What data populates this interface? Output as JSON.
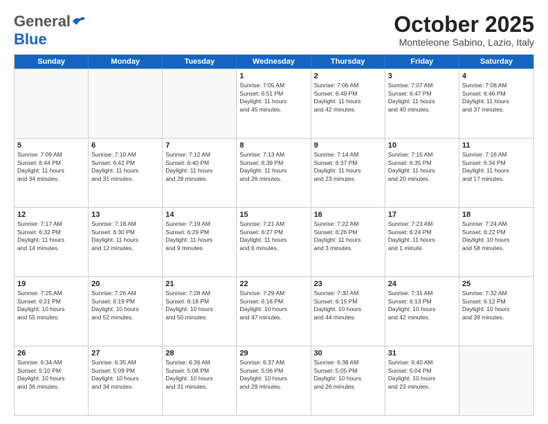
{
  "header": {
    "logo_general": "General",
    "logo_blue": "Blue",
    "month_title": "October 2025",
    "subtitle": "Monteleone Sabino, Lazio, Italy"
  },
  "days": [
    "Sunday",
    "Monday",
    "Tuesday",
    "Wednesday",
    "Thursday",
    "Friday",
    "Saturday"
  ],
  "rows": [
    [
      {
        "date": "",
        "info": ""
      },
      {
        "date": "",
        "info": ""
      },
      {
        "date": "",
        "info": ""
      },
      {
        "date": "1",
        "info": "Sunrise: 7:05 AM\nSunset: 6:51 PM\nDaylight: 11 hours\nand 45 minutes."
      },
      {
        "date": "2",
        "info": "Sunrise: 7:06 AM\nSunset: 6:49 PM\nDaylight: 11 hours\nand 42 minutes."
      },
      {
        "date": "3",
        "info": "Sunrise: 7:07 AM\nSunset: 6:47 PM\nDaylight: 11 hours\nand 40 minutes."
      },
      {
        "date": "4",
        "info": "Sunrise: 7:08 AM\nSunset: 6:46 PM\nDaylight: 11 hours\nand 37 minutes."
      }
    ],
    [
      {
        "date": "5",
        "info": "Sunrise: 7:09 AM\nSunset: 6:44 PM\nDaylight: 11 hours\nand 34 minutes."
      },
      {
        "date": "6",
        "info": "Sunrise: 7:10 AM\nSunset: 6:42 PM\nDaylight: 11 hours\nand 31 minutes."
      },
      {
        "date": "7",
        "info": "Sunrise: 7:12 AM\nSunset: 6:40 PM\nDaylight: 11 hours\nand 28 minutes."
      },
      {
        "date": "8",
        "info": "Sunrise: 7:13 AM\nSunset: 6:39 PM\nDaylight: 11 hours\nand 26 minutes."
      },
      {
        "date": "9",
        "info": "Sunrise: 7:14 AM\nSunset: 6:37 PM\nDaylight: 11 hours\nand 23 minutes."
      },
      {
        "date": "10",
        "info": "Sunrise: 7:15 AM\nSunset: 6:35 PM\nDaylight: 11 hours\nand 20 minutes."
      },
      {
        "date": "11",
        "info": "Sunrise: 7:16 AM\nSunset: 6:34 PM\nDaylight: 11 hours\nand 17 minutes."
      }
    ],
    [
      {
        "date": "12",
        "info": "Sunrise: 7:17 AM\nSunset: 6:32 PM\nDaylight: 11 hours\nand 14 minutes."
      },
      {
        "date": "13",
        "info": "Sunrise: 7:18 AM\nSunset: 6:30 PM\nDaylight: 11 hours\nand 12 minutes."
      },
      {
        "date": "14",
        "info": "Sunrise: 7:19 AM\nSunset: 6:29 PM\nDaylight: 11 hours\nand 9 minutes."
      },
      {
        "date": "15",
        "info": "Sunrise: 7:21 AM\nSunset: 6:27 PM\nDaylight: 11 hours\nand 6 minutes."
      },
      {
        "date": "16",
        "info": "Sunrise: 7:22 AM\nSunset: 6:26 PM\nDaylight: 11 hours\nand 3 minutes."
      },
      {
        "date": "17",
        "info": "Sunrise: 7:23 AM\nSunset: 6:24 PM\nDaylight: 11 hours\nand 1 minute."
      },
      {
        "date": "18",
        "info": "Sunrise: 7:24 AM\nSunset: 6:22 PM\nDaylight: 10 hours\nand 58 minutes."
      }
    ],
    [
      {
        "date": "19",
        "info": "Sunrise: 7:25 AM\nSunset: 6:21 PM\nDaylight: 10 hours\nand 55 minutes."
      },
      {
        "date": "20",
        "info": "Sunrise: 7:26 AM\nSunset: 6:19 PM\nDaylight: 10 hours\nand 52 minutes."
      },
      {
        "date": "21",
        "info": "Sunrise: 7:28 AM\nSunset: 6:18 PM\nDaylight: 10 hours\nand 50 minutes."
      },
      {
        "date": "22",
        "info": "Sunrise: 7:29 AM\nSunset: 6:16 PM\nDaylight: 10 hours\nand 47 minutes."
      },
      {
        "date": "23",
        "info": "Sunrise: 7:30 AM\nSunset: 6:15 PM\nDaylight: 10 hours\nand 44 minutes."
      },
      {
        "date": "24",
        "info": "Sunrise: 7:31 AM\nSunset: 6:13 PM\nDaylight: 10 hours\nand 42 minutes."
      },
      {
        "date": "25",
        "info": "Sunrise: 7:32 AM\nSunset: 6:12 PM\nDaylight: 10 hours\nand 39 minutes."
      }
    ],
    [
      {
        "date": "26",
        "info": "Sunrise: 6:34 AM\nSunset: 5:10 PM\nDaylight: 10 hours\nand 36 minutes."
      },
      {
        "date": "27",
        "info": "Sunrise: 6:35 AM\nSunset: 5:09 PM\nDaylight: 10 hours\nand 34 minutes."
      },
      {
        "date": "28",
        "info": "Sunrise: 6:36 AM\nSunset: 5:08 PM\nDaylight: 10 hours\nand 31 minutes."
      },
      {
        "date": "29",
        "info": "Sunrise: 6:37 AM\nSunset: 5:06 PM\nDaylight: 10 hours\nand 29 minutes."
      },
      {
        "date": "30",
        "info": "Sunrise: 6:38 AM\nSunset: 5:05 PM\nDaylight: 10 hours\nand 26 minutes."
      },
      {
        "date": "31",
        "info": "Sunrise: 6:40 AM\nSunset: 5:04 PM\nDaylight: 10 hours\nand 23 minutes."
      },
      {
        "date": "",
        "info": ""
      }
    ]
  ]
}
